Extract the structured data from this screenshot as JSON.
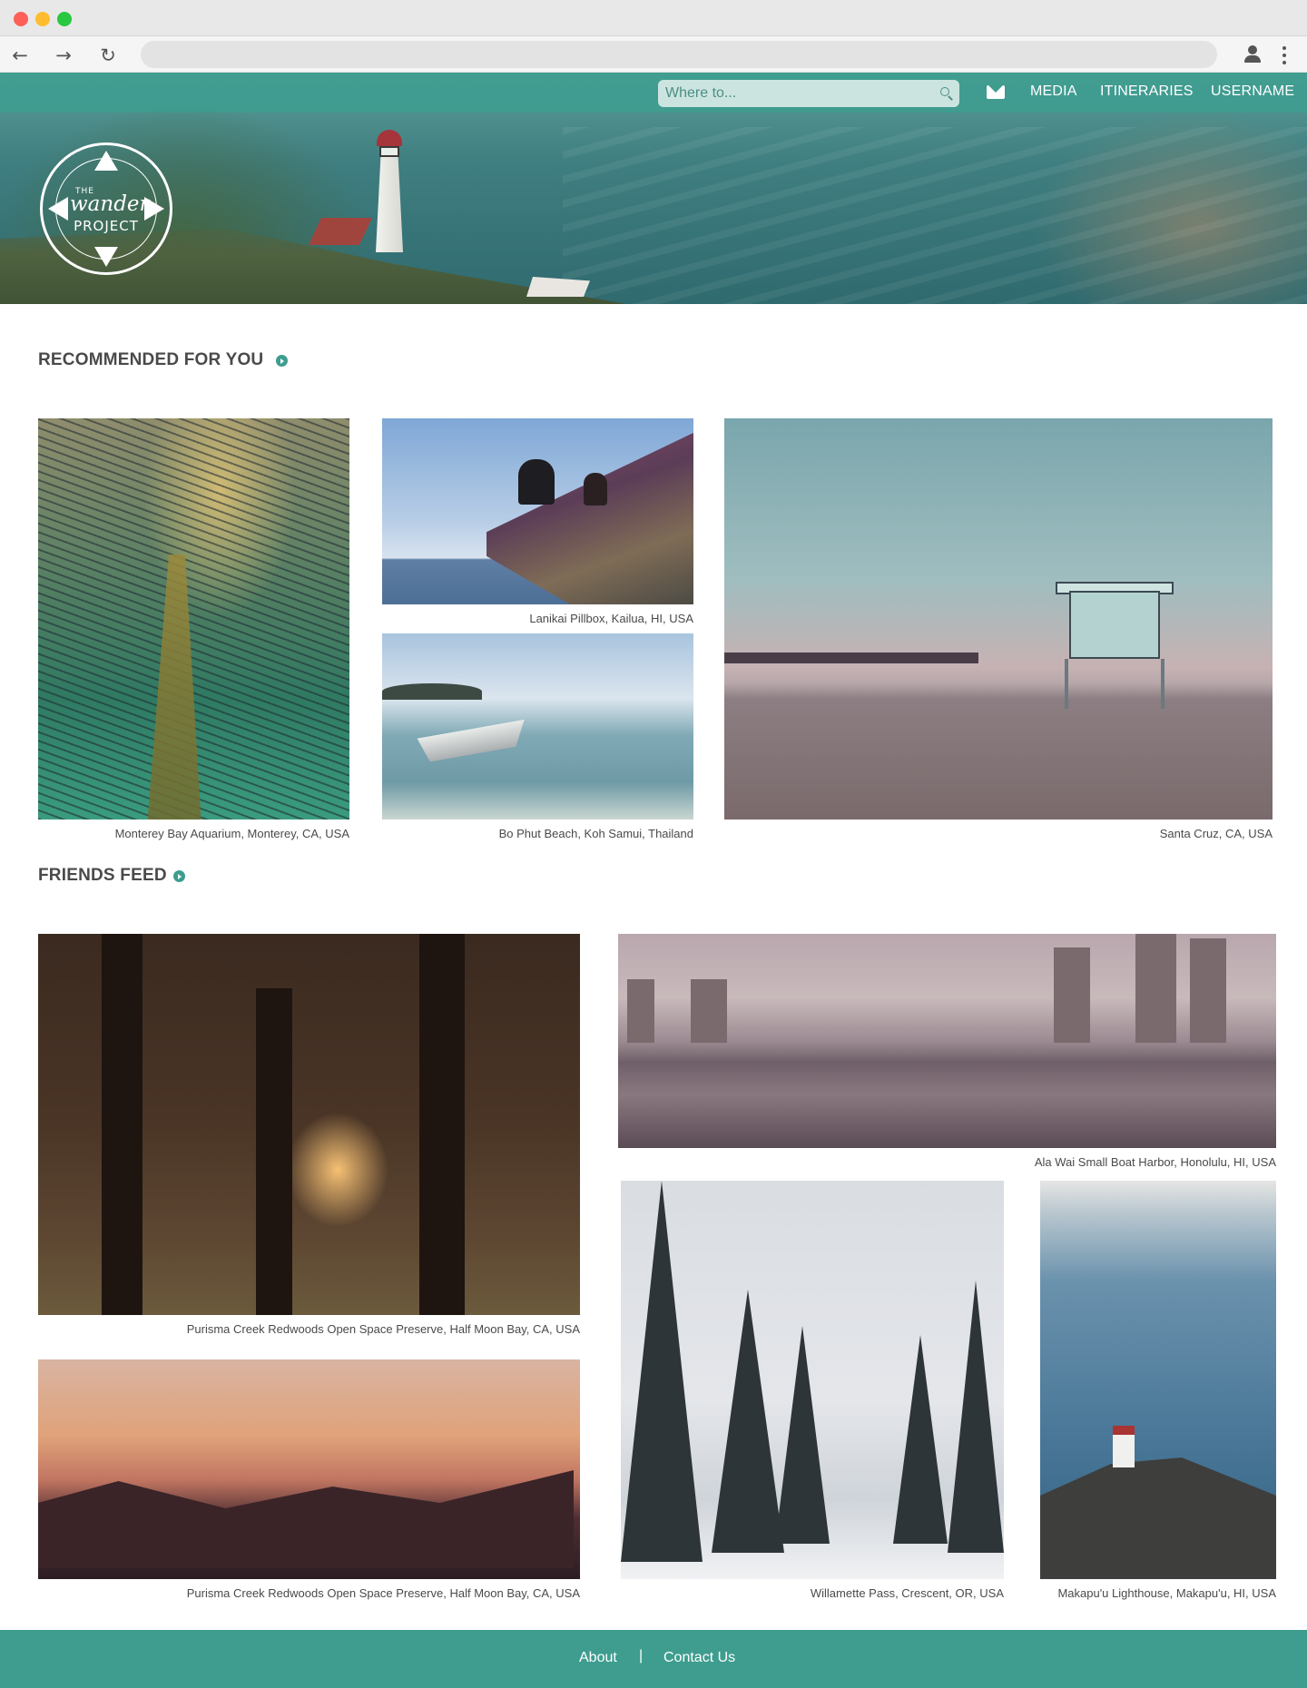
{
  "nav": {
    "search_placeholder": "Where to...",
    "media": "MEDIA",
    "itineraries": "ITINERARIES",
    "username": "USERNAME"
  },
  "brand": {
    "logo_text": "The Wander Project",
    "accent_color": "#3e9d8f"
  },
  "recommended": {
    "title": "RECOMMENDED FOR YOU",
    "items": [
      {
        "caption": "Monterey Bay Aquarium, Monterey, CA, USA"
      },
      {
        "caption": "Lanikai Pillbox, Kailua, HI, USA"
      },
      {
        "caption": "Bo Phut Beach, Koh Samui, Thailand"
      },
      {
        "caption": "Santa Cruz, CA, USA"
      }
    ]
  },
  "friends": {
    "title": "FRIENDS FEED",
    "items": [
      {
        "caption": "Purisma Creek Redwoods Open Space Preserve, Half Moon Bay, CA, USA"
      },
      {
        "caption": "Ala Wai Small Boat Harbor, Honolulu, HI, USA"
      },
      {
        "caption": "Purisma Creek Redwoods Open Space Preserve, Half Moon Bay, CA, USA"
      },
      {
        "caption": "Willamette Pass, Crescent, OR, USA"
      },
      {
        "caption": "Makapu'u Lighthouse, Makapu'u, HI, USA"
      }
    ]
  },
  "footer": {
    "about": "About",
    "separator": "|",
    "contact": "Contact Us"
  }
}
